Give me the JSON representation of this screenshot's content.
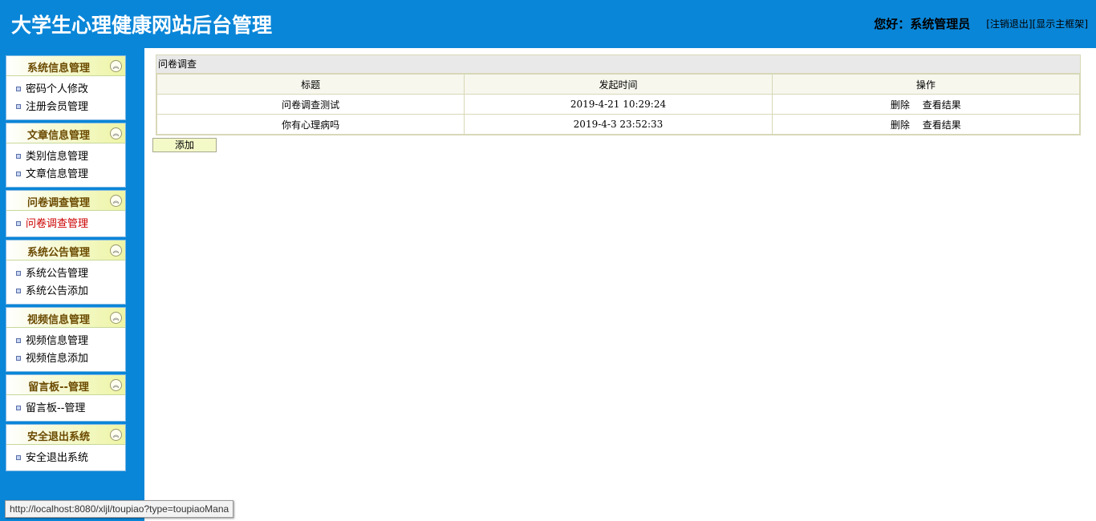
{
  "header": {
    "title": "大学生心理健康网站后台管理",
    "greeting": "您好：系统管理员",
    "logout_link": "注销退出",
    "frame_link": "显示主框架"
  },
  "sidebar": {
    "groups": [
      {
        "title": "系统信息管理",
        "items": [
          "密码个人修改",
          "注册会员管理"
        ]
      },
      {
        "title": "文章信息管理",
        "items": [
          "类别信息管理",
          "文章信息管理"
        ]
      },
      {
        "title": "问卷调查管理",
        "items": [
          "问卷调查管理"
        ]
      },
      {
        "title": "系统公告管理",
        "items": [
          "系统公告管理",
          "系统公告添加"
        ]
      },
      {
        "title": "视频信息管理",
        "items": [
          "视频信息管理",
          "视频信息添加"
        ]
      },
      {
        "title": "留言板--管理",
        "items": [
          "留言板--管理"
        ]
      },
      {
        "title": "安全退出系统",
        "items": [
          "安全退出系统"
        ]
      }
    ],
    "active_item": "问卷调查管理",
    "collapse_icon": "double-chevron-up-icon"
  },
  "main": {
    "panel_title": "问卷调查",
    "columns": [
      "标题",
      "发起时间",
      "操作"
    ],
    "rows": [
      {
        "title": "问卷调查测试",
        "time": "2019-4-21 10:29:24",
        "delete": "删除",
        "view": "查看结果"
      },
      {
        "title": "你有心理病吗",
        "time": "2019-4-3 23:52:33",
        "delete": "删除",
        "view": "查看结果"
      }
    ],
    "add_button": "添加"
  },
  "status_bar": {
    "url": "http://localhost:8080/xljl/toupiao?type=toupiaoMana"
  },
  "colors": {
    "brand_blue": "#0a86d8",
    "active_red": "#cc0000"
  }
}
